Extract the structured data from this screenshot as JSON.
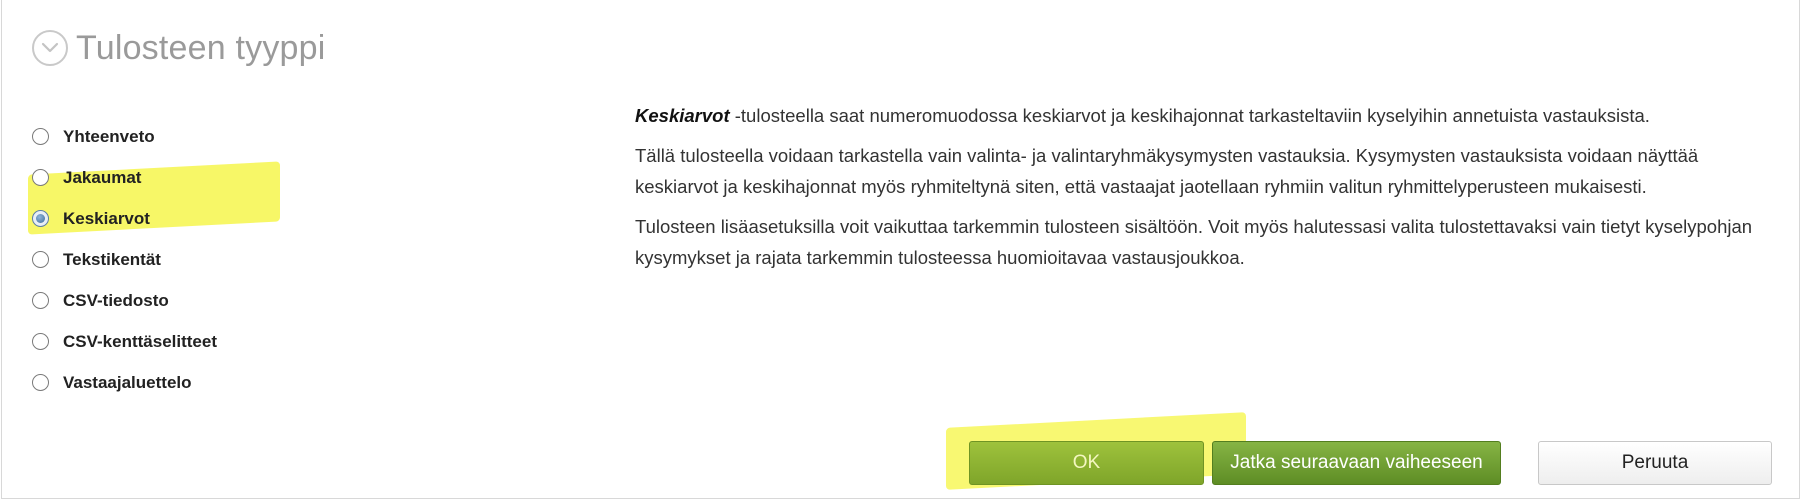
{
  "header": {
    "title": "Tulosteen tyyppi",
    "icon": "chevron-down-circle-icon"
  },
  "report_types": {
    "selected": "Keskiarvot",
    "options": [
      {
        "label": "Yhteenveto",
        "checked": false
      },
      {
        "label": "Jakaumat",
        "checked": false
      },
      {
        "label": "Keskiarvot",
        "checked": true
      },
      {
        "label": "Tekstikentät",
        "checked": false
      },
      {
        "label": "CSV-tiedosto",
        "checked": false
      },
      {
        "label": "CSV-kenttäselitteet",
        "checked": false
      },
      {
        "label": "Vastaajaluettelo",
        "checked": false
      }
    ]
  },
  "description": {
    "emphasis": "Keskiarvot",
    "p1_rest": " -tulosteella saat numeromuodossa keskiarvot ja keskihajonnat tarkasteltaviin kyselyihin annetuista vastauksista.",
    "p2": "Tällä tulosteella voidaan tarkastella vain valinta- ja valintaryhmäkysymysten vastauksia. Kysymysten vastauksista voidaan näyttää keskiarvot ja keskihajonnat myös ryhmiteltynä siten, että vastaajat jaotellaan ryhmiin valitun ryhmittelyperusteen mukaisesti.",
    "p3": "Tulosteen lisäasetuksilla voit vaikuttaa tarkemmin tulosteen sisältöön. Voit myös halutessasi valita tulostettavaksi vain tietyt kyselypohjan kysymykset ja rajata tarkemmin tulosteessa huomioitavaa vastausjoukkoa."
  },
  "buttons": {
    "ok": "OK",
    "next": "Jatka seuraavaan vaiheeseen",
    "cancel": "Peruuta"
  },
  "colors": {
    "highlight": "#f5f53c",
    "ok_button": "#8fb534",
    "next_button": "#6e9c2e",
    "title_gray": "#9a9a9a"
  }
}
